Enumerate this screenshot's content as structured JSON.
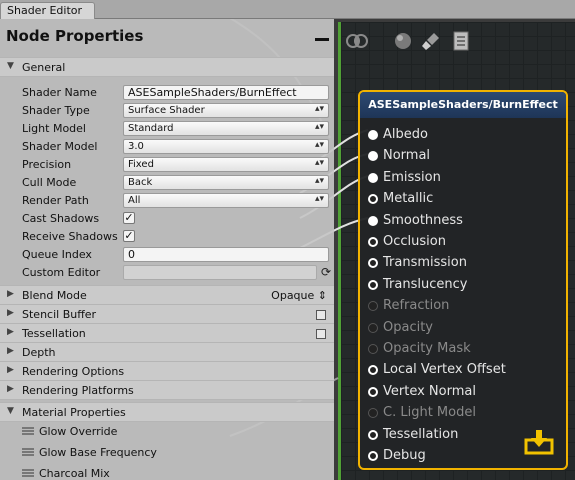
{
  "window": {
    "tab_title": "Shader Editor"
  },
  "panel": {
    "title": "Node Properties",
    "sections": {
      "general": "General",
      "blend_mode": "Blend Mode",
      "blend_mode_value": "Opaque",
      "stencil_buffer": "Stencil Buffer",
      "tessellation": "Tessellation",
      "depth": "Depth",
      "rendering_options": "Rendering Options",
      "rendering_platforms": "Rendering Platforms",
      "material_properties": "Material Properties"
    },
    "general": {
      "shader_name": {
        "label": "Shader Name",
        "value": "ASESampleShaders/BurnEffect"
      },
      "shader_type": {
        "label": "Shader Type",
        "value": "Surface Shader"
      },
      "light_model": {
        "label": "Light Model",
        "value": "Standard"
      },
      "shader_model": {
        "label": "Shader Model",
        "value": "3.0"
      },
      "precision": {
        "label": "Precision",
        "value": "Fixed"
      },
      "cull_mode": {
        "label": "Cull Mode",
        "value": "Back"
      },
      "render_path": {
        "label": "Render Path",
        "value": "All"
      },
      "cast_shadows": {
        "label": "Cast Shadows",
        "checked": true
      },
      "receive_shadows": {
        "label": "Receive Shadows",
        "checked": true
      },
      "queue_index": {
        "label": "Queue Index",
        "value": "0"
      },
      "custom_editor": {
        "label": "Custom Editor",
        "value": ""
      }
    },
    "material_properties": [
      "Glow Override",
      "Glow Base Frequency",
      "Charcoal Mix"
    ]
  },
  "node": {
    "title": "ASESampleShaders/BurnEffect",
    "ports": [
      {
        "label": "Albedo",
        "state": "connected"
      },
      {
        "label": "Normal",
        "state": "connected"
      },
      {
        "label": "Emission",
        "state": "connected"
      },
      {
        "label": "Metallic",
        "state": "open"
      },
      {
        "label": "Smoothness",
        "state": "connected"
      },
      {
        "label": "Occlusion",
        "state": "open"
      },
      {
        "label": "Transmission",
        "state": "open"
      },
      {
        "label": "Translucency",
        "state": "open"
      },
      {
        "label": "Refraction",
        "state": "disabled"
      },
      {
        "label": "Opacity",
        "state": "disabled"
      },
      {
        "label": "Opacity Mask",
        "state": "disabled"
      },
      {
        "label": "Local Vertex Offset",
        "state": "open"
      },
      {
        "label": "Vertex Normal",
        "state": "open"
      },
      {
        "label": "C. Light Model",
        "state": "disabled"
      },
      {
        "label": "Tessellation",
        "state": "open"
      },
      {
        "label": "Debug",
        "state": "open"
      }
    ]
  },
  "colors": {
    "node_border": "#f2b300",
    "node_header": "#2e4a72",
    "grid_border": "#50a035",
    "save_icon": "#f2c200"
  },
  "icons": [
    "live-preview-icon",
    "material-sphere-icon",
    "clean-brush-icon",
    "shader-document-icon",
    "save-download-icon",
    "refresh-icon",
    "minimize-icon"
  ]
}
